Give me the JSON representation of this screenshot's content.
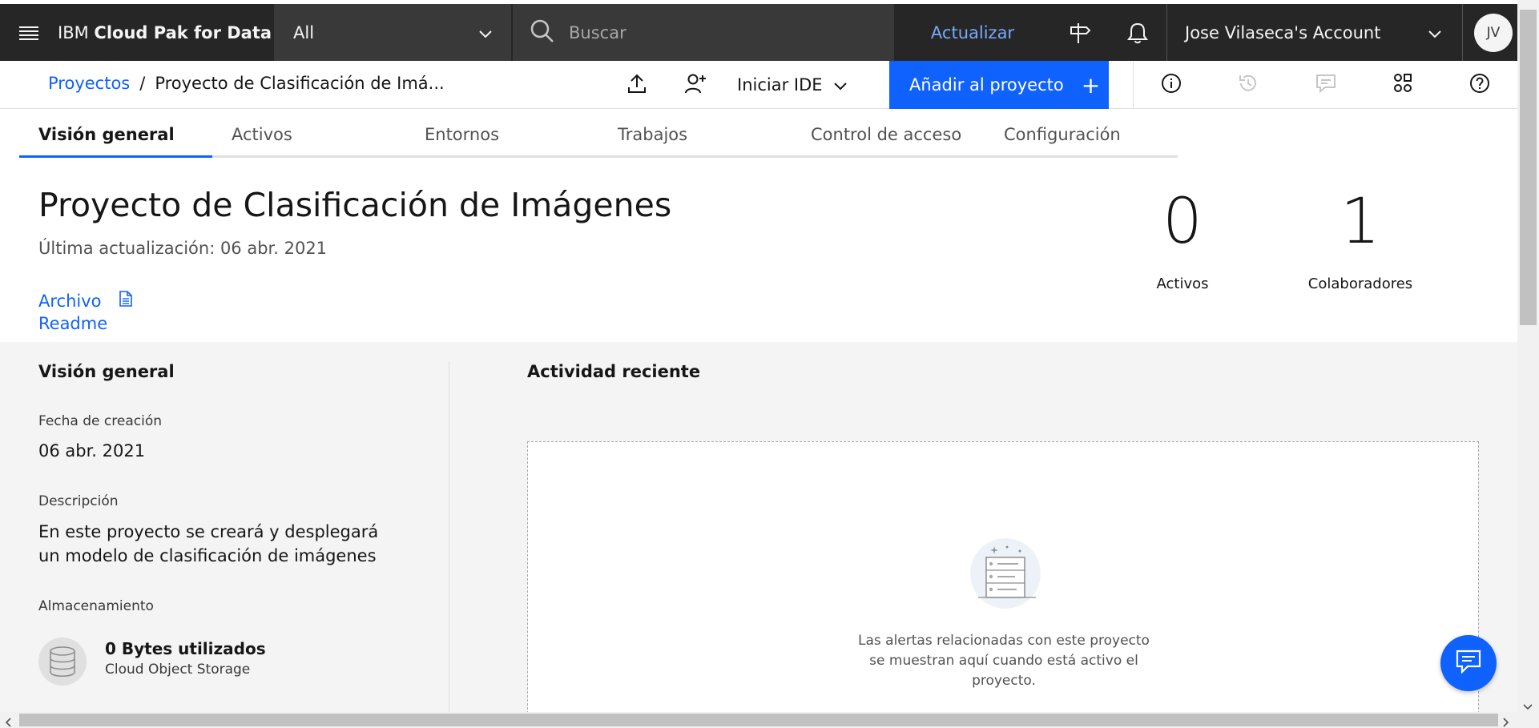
{
  "header": {
    "brand_prefix": "IBM",
    "brand_name": "Cloud Pak for Data",
    "scope_value": "All",
    "search_placeholder": "Buscar",
    "upgrade_label": "Actualizar",
    "account_name": "Jose Vilaseca's Account",
    "avatar_initials": "JV"
  },
  "project_bar": {
    "breadcrumb_root": "Proyectos",
    "breadcrumb_separator": "/",
    "breadcrumb_current": "Proyecto de Clasificación de Imá...",
    "ide_label": "Iniciar IDE",
    "add_label": "Añadir al proyecto",
    "add_plus": "+"
  },
  "tabs": [
    {
      "label": "Visión general",
      "active": true
    },
    {
      "label": "Activos",
      "active": false
    },
    {
      "label": "Entornos",
      "active": false
    },
    {
      "label": "Trabajos",
      "active": false
    },
    {
      "label": "Control de acceso",
      "active": false
    },
    {
      "label": "Configuración",
      "active": false
    }
  ],
  "project": {
    "title": "Proyecto de Clasificación de Imágenes",
    "updated": "Última actualización: 06 abr. 2021",
    "link_archive": "Archivo",
    "link_readme": "Readme"
  },
  "stats": [
    {
      "value": "0",
      "label": "Activos"
    },
    {
      "value": "1",
      "label": "Colaboradores"
    }
  ],
  "overview": {
    "title": "Visión general",
    "created_label": "Fecha de creación",
    "created_value": "06 abr. 2021",
    "description_label": "Descripción",
    "description_value": "En este proyecto se creará y desplegará un modelo de clasificación de imágenes",
    "storage_label": "Almacenamiento",
    "storage_used": "0 Bytes utilizados",
    "storage_type": "Cloud Object Storage"
  },
  "activity": {
    "title": "Actividad reciente",
    "empty_message": "Las alertas relacionadas con este proyecto se muestran aquí cuando está activo el proyecto."
  },
  "colors": {
    "header_bg": "#262626",
    "primary": "#0f62fe",
    "link": "#0f62fe",
    "panel_bg": "#f4f4f4"
  }
}
